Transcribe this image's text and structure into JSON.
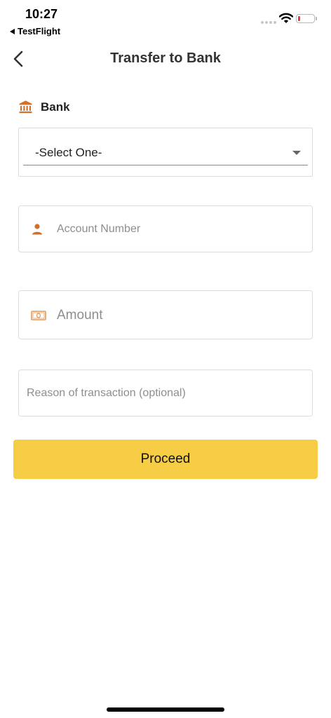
{
  "status_bar": {
    "time": "10:27",
    "back_app": "TestFlight",
    "battery_color": "#e53935"
  },
  "header": {
    "title": "Transfer to Bank",
    "back_icon": "chevron-left-icon"
  },
  "bank": {
    "label": "Bank",
    "icon": "bank-icon",
    "selected": "-Select One-"
  },
  "account": {
    "placeholder": "Account Number",
    "value": "",
    "icon": "person-icon"
  },
  "amount": {
    "placeholder": "Amount",
    "value": "",
    "icon": "cash-icon"
  },
  "reason": {
    "placeholder": "Reason of transaction (optional)",
    "value": ""
  },
  "actions": {
    "proceed_label": "Proceed"
  },
  "colors": {
    "accent": "#f7cd45",
    "icon_accent": "#d2702a"
  }
}
